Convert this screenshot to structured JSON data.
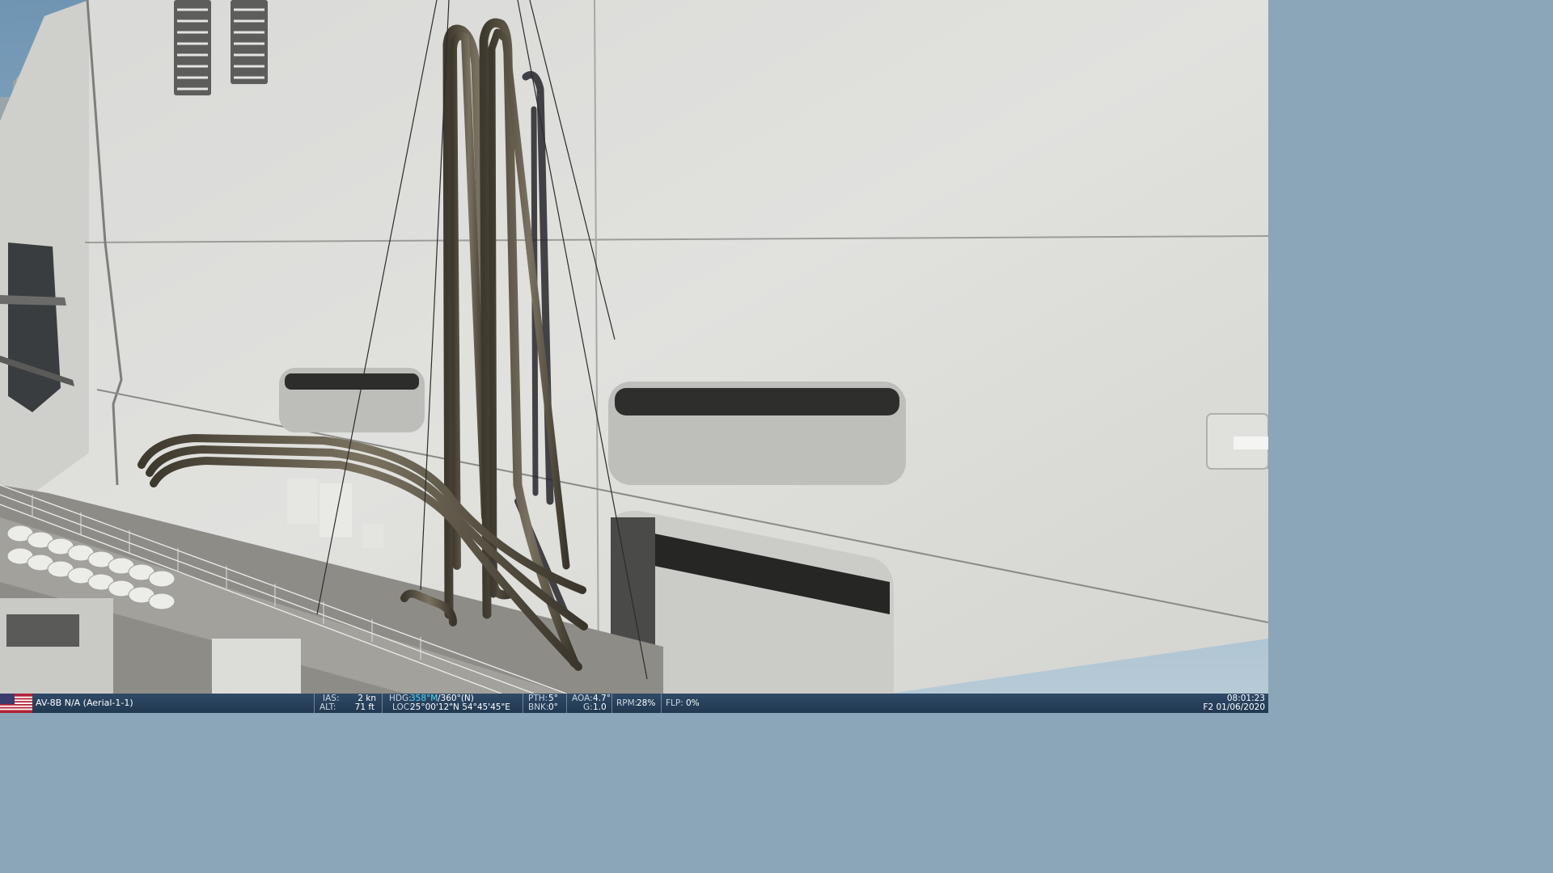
{
  "unit": {
    "flag_icon": "us-flag-icon",
    "name": "AV-8B N/A (Aerial-1-1)"
  },
  "telemetry": {
    "ias_label": "IAS:",
    "ias_value": "2 kn",
    "alt_label": "ALT:",
    "alt_value": "71 ft",
    "hdg_label": "HDG:",
    "hdg_mag": "358°M",
    "hdg_true": "/360°(N)",
    "loc_label": "LOC:",
    "loc_value": "25°00'12\"N 54°45'45\"E",
    "pth_label": "PTH:",
    "pth_value": "5°",
    "bnk_label": "BNK:",
    "bnk_value": "0°",
    "aoa_label": "AOA:",
    "aoa_value": "4.7°",
    "g_label": "G:",
    "g_value": "1.0",
    "rpm_label": "RPM:",
    "rpm_value": "28%",
    "flp_label": "FLP:",
    "flp_value": "0%"
  },
  "clock": {
    "time": "08:01:23",
    "date": "F2 01/06/2020"
  },
  "colors": {
    "statusbar": "#2a4361",
    "highlight": "#4fd8ff",
    "hull": "#dcdcd8",
    "deck": "#8e8c87",
    "hose": "#5a5344"
  }
}
